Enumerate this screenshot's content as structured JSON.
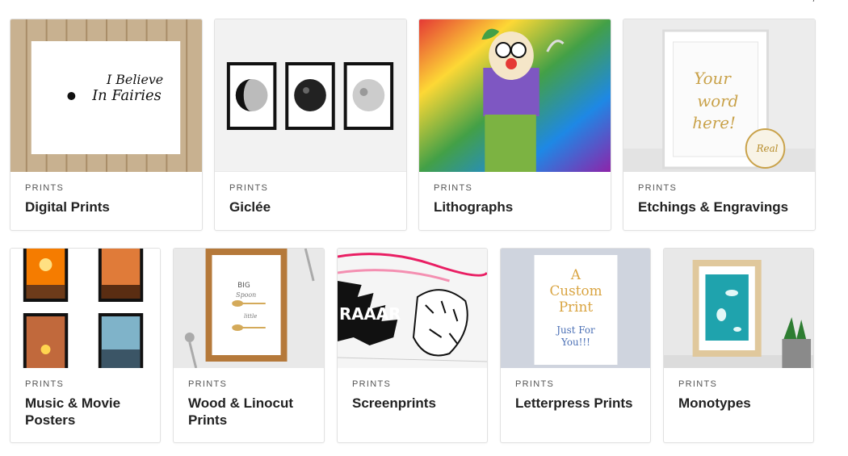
{
  "page_cutoff_text": "/",
  "categories_row1": [
    {
      "kicker": "PRINTS",
      "title": "Digital Prints",
      "image_text": [
        "I Believe",
        "In Fairies"
      ]
    },
    {
      "kicker": "PRINTS",
      "title": "Giclée"
    },
    {
      "kicker": "PRINTS",
      "title": "Lithographs"
    },
    {
      "kicker": "PRINTS",
      "title": "Etchings & Engravings",
      "image_text": [
        "Your",
        "word",
        "here!",
        "Real"
      ]
    }
  ],
  "categories_row2": [
    {
      "kicker": "PRINTS",
      "title": "Music & Movie Posters"
    },
    {
      "kicker": "PRINTS",
      "title": "Wood & Linocut Prints",
      "image_text": [
        "BIG",
        "Spoon",
        "little",
        "Spoon"
      ]
    },
    {
      "kicker": "PRINTS",
      "title": "Screenprints",
      "image_text": [
        "RAAAR"
      ]
    },
    {
      "kicker": "PRINTS",
      "title": "Letterpress Prints",
      "image_text": [
        "A",
        "Custom",
        "Print",
        "Just For",
        "You!!!"
      ]
    },
    {
      "kicker": "PRINTS",
      "title": "Monotypes"
    }
  ],
  "colors": {
    "border": "#e1e1e1",
    "kicker": "#555555",
    "title": "#222222"
  }
}
